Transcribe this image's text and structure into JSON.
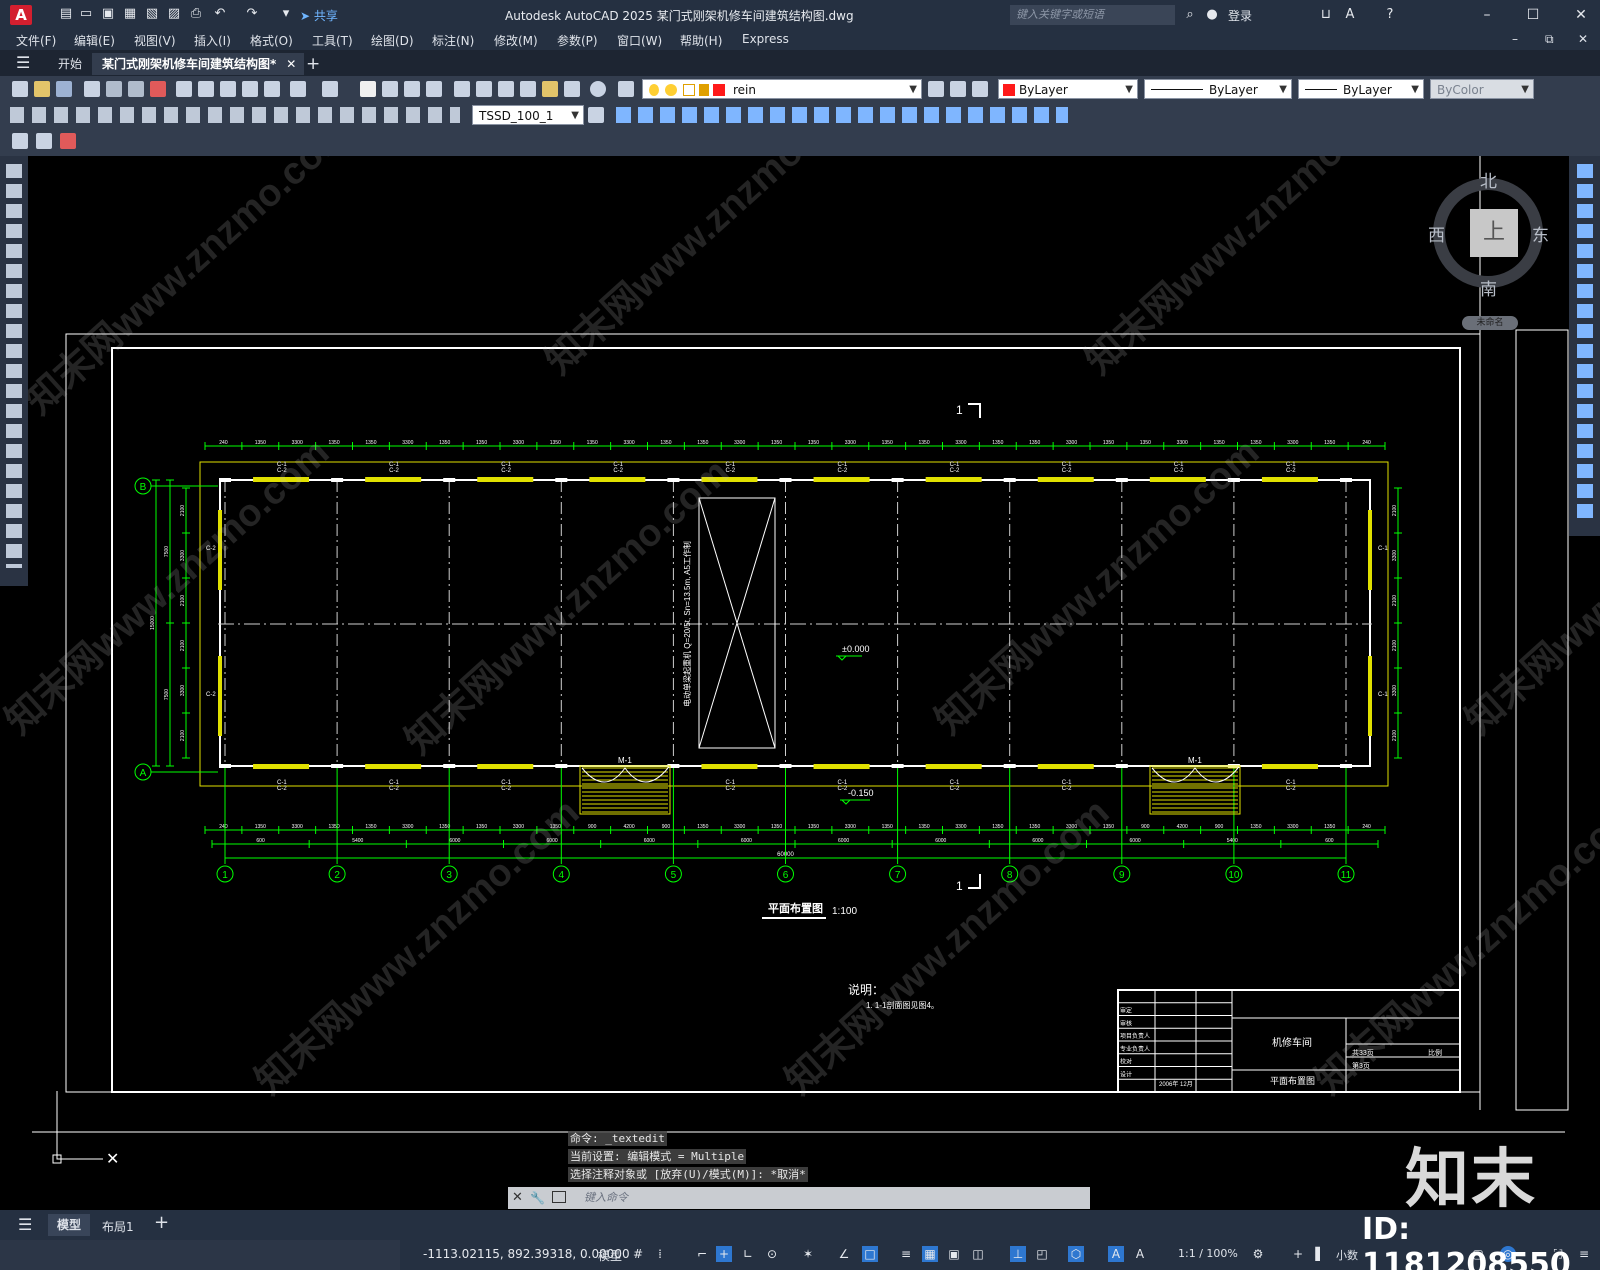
{
  "app": {
    "logo": "A",
    "share": "共享",
    "title": "Autodesk AutoCAD 2025    某门式刚架机修车间建筑结构图.dwg",
    "search_placeholder": "键入关键字或短语",
    "login": "登录"
  },
  "menu": [
    "文件(F)",
    "编辑(E)",
    "视图(V)",
    "插入(I)",
    "格式(O)",
    "工具(T)",
    "绘图(D)",
    "标注(N)",
    "修改(M)",
    "参数(P)",
    "窗口(W)",
    "帮助(H)",
    "Express"
  ],
  "tabs": {
    "start": "开始",
    "active": "某门式刚架机修车间建筑结构图*"
  },
  "toolbar": {
    "layer": "rein",
    "color": "ByLayer",
    "linetype": "ByLayer",
    "lineweight": "ByLayer",
    "plotstyle": "ByColor",
    "dimstyle": "TSSD_100_1"
  },
  "viewcube": {
    "north": "北",
    "south": "南",
    "east": "东",
    "west": "西",
    "top": "上",
    "wcs": "未命名"
  },
  "drawing": {
    "section_mark": "1",
    "axes_numbers": [
      "1",
      "2",
      "3",
      "4",
      "5",
      "6",
      "7",
      "8",
      "9",
      "10",
      "11"
    ],
    "axes_letters": [
      "B",
      "A"
    ],
    "top_dims": [
      "240",
      "1350",
      "3300",
      "1350",
      "1350",
      "3300",
      "1350",
      "1350",
      "3300",
      "1350",
      "1350",
      "3300",
      "1350",
      "1350",
      "3300",
      "1350",
      "1350",
      "3300",
      "1350",
      "1350",
      "3300",
      "1350",
      "1350",
      "3300",
      "1350",
      "1350",
      "3300",
      "1350",
      "1350",
      "3300",
      "1350",
      "240"
    ],
    "bottom_dims_1": [
      "240",
      "1350",
      "3300",
      "1350",
      "1350",
      "3300",
      "1350",
      "1350",
      "3300",
      "1350",
      "900",
      "4200",
      "900",
      "1350",
      "3300",
      "1350",
      "1350",
      "3300",
      "1350",
      "1350",
      "3300",
      "1350",
      "1350",
      "3300",
      "1350",
      "900",
      "4200",
      "900",
      "1350",
      "3300",
      "1350",
      "240"
    ],
    "bottom_dims_2": [
      "600",
      "5400",
      "6000",
      "6000",
      "6000",
      "6000",
      "6000",
      "6000",
      "6000",
      "6000",
      "5400",
      "600"
    ],
    "overall_length": "60000",
    "left_overall": "15000",
    "left_dims": [
      "7500",
      "7500"
    ],
    "left_sub_dims": [
      "2100",
      "3300",
      "2100",
      "2100",
      "3300",
      "2100"
    ],
    "window_labels_top": [
      "C-2",
      "C-1"
    ],
    "window_labels_bottom": [
      "C-1",
      "C-2"
    ],
    "door_label": "M-1",
    "crane_text": "电动单梁起重机 Q=20/5t, Sn=13.5m, A5工作制",
    "elev_floor": "±0.000",
    "elev_outside": "-0.150",
    "plan_title": "平面布置图",
    "plan_scale": "1:100",
    "notes_title": "说明：",
    "notes_line": "1. 1-1剖面图见图4。",
    "titleblock": {
      "left_rows": [
        "审定",
        "审核",
        "项目负责人",
        "专业负责人",
        "校对",
        "设计"
      ],
      "left_vals": [
        "",
        "",
        "",
        "",
        "",
        ""
      ],
      "project": "机修车间",
      "drawing_name": "平面布置图",
      "date": "2006年 12月",
      "sheet": "共33页",
      "scale_label": "比例",
      "scale_label2": "第3页"
    }
  },
  "command": {
    "line1": "命令: _textedit",
    "line2": "当前设置: 编辑模式 = Multiple",
    "line3": "选择注释对象或 [放弃(U)/模式(M)]: *取消*",
    "input_placeholder": "键入命令"
  },
  "layouts": {
    "model": "模型",
    "layout1": "布局1"
  },
  "status": {
    "coords": "-1113.02115, 892.39318, 0.00000",
    "model": "模型",
    "scale": "1:1 / 100%",
    "units": "小数"
  },
  "watermark": {
    "big": "知末",
    "id": "ID: 1181208550",
    "text": "知末网www.znzmo.com"
  }
}
